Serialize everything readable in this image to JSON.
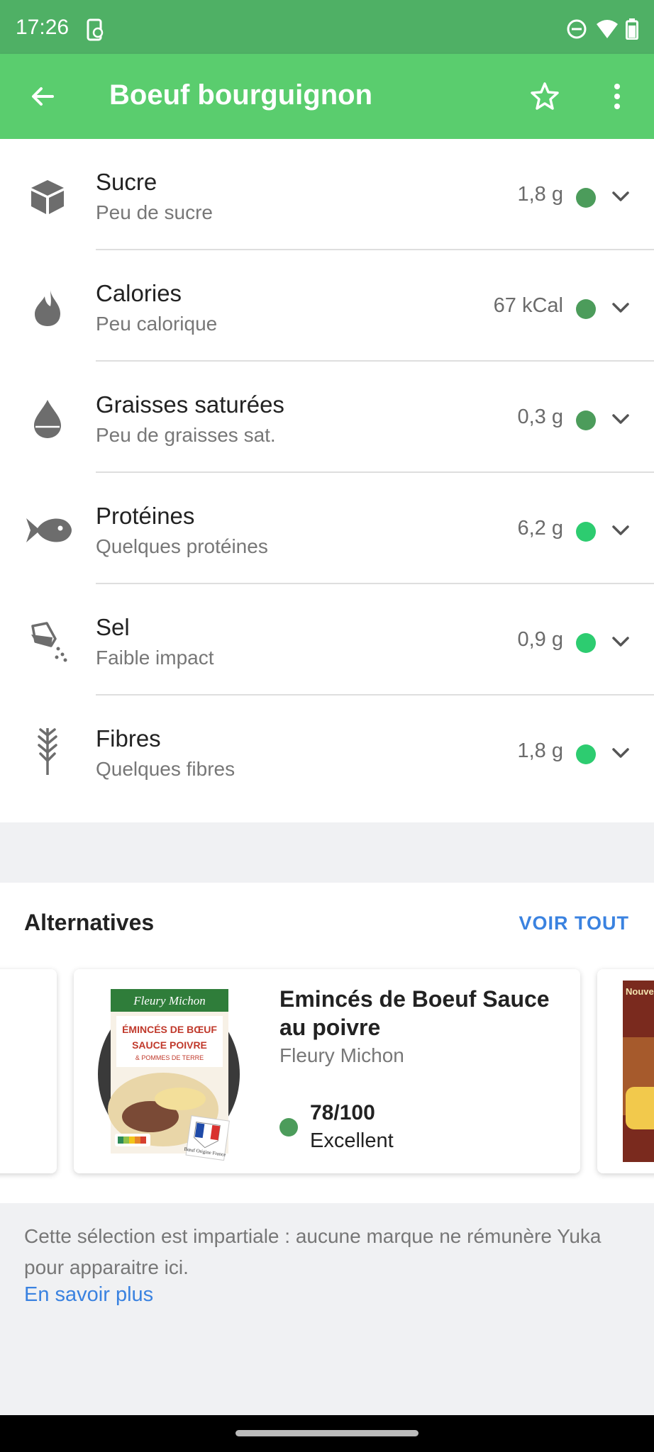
{
  "status_bar": {
    "time": "17:26",
    "icons": [
      "phone-sync-icon",
      "dnd-icon",
      "wifi-icon",
      "battery-icon"
    ]
  },
  "app_bar": {
    "title": "Boeuf bourguignon",
    "back_icon": "back-arrow-icon",
    "favorite_icon": "star-icon",
    "menu_icon": "more-vert-icon"
  },
  "nutrients": [
    {
      "name": "Sucre",
      "desc": "Peu de sucre",
      "value": "1,8 g",
      "icon": "sugar-cube-icon",
      "color": "#4c9c5b"
    },
    {
      "name": "Calories",
      "desc": "Peu calorique",
      "value": "67 kCal",
      "icon": "flame-icon",
      "color": "#4c9c5b"
    },
    {
      "name": "Graisses saturées",
      "desc": "Peu de graisses sat.",
      "value": "0,3 g",
      "icon": "drop-icon",
      "color": "#4c9c5b"
    },
    {
      "name": "Protéines",
      "desc": "Quelques protéines",
      "value": "6,2 g",
      "icon": "fish-icon",
      "color": "#2dcc70"
    },
    {
      "name": "Sel",
      "desc": "Faible impact",
      "value": "0,9 g",
      "icon": "salt-shaker-icon",
      "color": "#2dcc70"
    },
    {
      "name": "Fibres",
      "desc": "Quelques fibres",
      "value": "1,8 g",
      "icon": "wheat-icon",
      "color": "#2dcc70"
    }
  ],
  "alternatives": {
    "title": "Alternatives",
    "see_all": "VOIR TOUT",
    "product": {
      "name": "Emincés de Boeuf Sauce au poivre",
      "brand": "Fleury Michon",
      "score": "78/100",
      "rating": "Excellent",
      "score_color": "#4c9c5b",
      "package_brand": "Fleury Michon",
      "package_title": "ÉMINCÉS DE BŒUF SAUCE POIVRE",
      "package_sub": "& POMMES DE TERRE",
      "package_badge": "Bœuf Origine France"
    },
    "neighbor_label": "Nouvelle"
  },
  "disclaimer": {
    "text": "Cette sélection est impartiale : aucune marque ne rémunère Yuka pour apparaitre ici.",
    "link": "En savoir plus"
  }
}
